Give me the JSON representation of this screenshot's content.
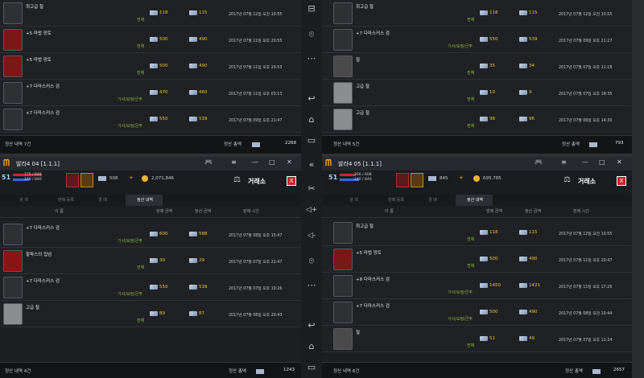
{
  "sidebar": {
    "items": [
      {
        "icon": "minus-window-icon",
        "glyph": "⊟"
      },
      {
        "icon": "location-pin-icon",
        "glyph": "⌾"
      },
      {
        "icon": "more-icon",
        "glyph": "⋯"
      },
      {
        "icon": "back-icon",
        "glyph": "↩"
      },
      {
        "icon": "home-icon",
        "glyph": "⌂"
      },
      {
        "icon": "recent-apps-icon",
        "glyph": "▭"
      },
      {
        "icon": "collapse-icon",
        "glyph": "«"
      },
      {
        "icon": "scissors-icon",
        "glyph": "✂"
      },
      {
        "icon": "volume-up-icon",
        "glyph": "◁+"
      },
      {
        "icon": "volume-down-icon",
        "glyph": "◁-"
      },
      {
        "icon": "location-pin-icon",
        "glyph": "⌾"
      },
      {
        "icon": "more-icon",
        "glyph": "⋯"
      },
      {
        "icon": "back-icon",
        "glyph": "↩"
      },
      {
        "icon": "home-icon",
        "glyph": "⌂"
      },
      {
        "icon": "recent-apps-icon",
        "glyph": "▭"
      }
    ]
  },
  "common": {
    "tabs": [
      "검 색",
      "판매 등록",
      "경 매",
      "정산 내역"
    ],
    "col_headers": [
      "이 름",
      "판매 금액",
      "정산 금액",
      "판매 시간"
    ],
    "exchange_title": "거래소",
    "close_label": "X",
    "total_label": "정산 총액"
  },
  "panes": {
    "top_left": {
      "rows": [
        {
          "name": "최고급 철",
          "cls": "전체",
          "sale": "118",
          "settle": "115",
          "date": "2017년 07월 12일 오전 10:55",
          "icon": "iron-scroll-icon"
        },
        {
          "name": "+5 마법 망토",
          "cls": "전체",
          "sale": "500",
          "settle": "490",
          "date": "2017년 07월 11일 오후 20:55",
          "icon": "red-cloak-icon"
        },
        {
          "name": "+5 마법 망토",
          "cls": "전체",
          "sale": "500",
          "settle": "490",
          "date": "2017년 07월 11일 오후 20:53",
          "icon": "red-cloak-icon"
        },
        {
          "name": "+7 다마스커스 검",
          "cls": "기사/요정/군주",
          "sale": "470",
          "settle": "460",
          "date": "2017년 07월 11일 오후 03:13",
          "icon": "sword-icon"
        },
        {
          "name": "+7 다마스커스 검",
          "cls": "기사/요정/군주",
          "sale": "550",
          "settle": "539",
          "date": "2017년 07월 09일 오후 21:47",
          "icon": "sword-icon"
        }
      ],
      "count_label": "정산 내역 7건",
      "total": "2268"
    },
    "top_right": {
      "rows": [
        {
          "name": "최고급 철",
          "cls": "전체",
          "sale": "118",
          "settle": "115",
          "date": "2017년 07월 12일 오전 10:55",
          "icon": "iron-scroll-icon"
        },
        {
          "name": "+7 다마스커스 검",
          "cls": "기사/요정/군주",
          "sale": "550",
          "settle": "539",
          "date": "2017년 07월 09일 오후 21:27",
          "icon": "sword-icon"
        },
        {
          "name": "철",
          "cls": "전체",
          "sale": "35",
          "settle": "34",
          "date": "2017년 07월 07일 오후 21:18",
          "icon": "iron-icon"
        },
        {
          "name": "고급 철",
          "cls": "전체",
          "sale": "10",
          "settle": "9",
          "date": "2017년 07월 07일 오후 18:35",
          "icon": "iron-plate-icon"
        },
        {
          "name": "고급 철",
          "cls": "전체",
          "sale": "98",
          "settle": "96",
          "date": "2017년 07월 06일 오후 14:30",
          "icon": "iron-plate-icon"
        }
      ],
      "count_label": "정산 내역 5건",
      "total": "793"
    },
    "bottom_left": {
      "title": "발라4 04",
      "version": "[1.1.1]",
      "hud": {
        "level": "51",
        "hp": "775 / 848",
        "mp": "168 / 840",
        "cur1": "508",
        "gold": "2,071,846"
      },
      "rows": [
        {
          "name": "+7 다마스커스 검",
          "cls": "기사/요정/군주",
          "sale": "600",
          "settle": "588",
          "date": "2017년 07월 08일 오후 15:47",
          "icon": "sword-icon"
        },
        {
          "name": "할파스의 집념",
          "cls": "전체",
          "sale": "30",
          "settle": "29",
          "date": "2017년 07월 07일 오후 22:47",
          "icon": "red-gem-icon"
        },
        {
          "name": "+7 다마스커스 검",
          "cls": "기사/요정/군주",
          "sale": "550",
          "settle": "539",
          "date": "2017년 07월 07일 오후 19:26",
          "icon": "sword-icon"
        },
        {
          "name": "고급 철",
          "cls": "전체",
          "sale": "89",
          "settle": "87",
          "date": "2017년 07월 06일 오후 20:43",
          "icon": "iron-plate-icon"
        }
      ],
      "count_label": "정산 내역 4건",
      "total": "1243"
    },
    "bottom_right": {
      "title": "발라4 05",
      "version": "[1.1.1]",
      "hud": {
        "level": "51",
        "hp": "266 / 608",
        "mp": "240 / 840",
        "cur1": "845",
        "gold": "695,785"
      },
      "rows": [
        {
          "name": "최고급 철",
          "cls": "전체",
          "sale": "118",
          "settle": "115",
          "date": "2017년 07월 12일 오전 10:55",
          "icon": "iron-scroll-icon"
        },
        {
          "name": "+5 마법 망토",
          "cls": "전체",
          "sale": "500",
          "settle": "490",
          "date": "2017년 07월 11일 오후 20:47",
          "icon": "red-cloak-icon"
        },
        {
          "name": "+8 다마스커스 검",
          "cls": "기사/요정/군주",
          "sale": "1450",
          "settle": "1421",
          "date": "2017년 07월 11일 오후 17:26",
          "icon": "sword-icon"
        },
        {
          "name": "+7 다마스커스 검",
          "cls": "기사/요정/군주",
          "sale": "500",
          "settle": "490",
          "date": "2017년 07월 08일 오전 10:44",
          "icon": "sword-icon"
        },
        {
          "name": "철",
          "cls": "전체",
          "sale": "51",
          "settle": "49",
          "date": "2017년 07월 07일 오후 12:24",
          "icon": "iron-icon"
        }
      ],
      "count_label": "정산 내역 6건",
      "total": "2657"
    }
  }
}
